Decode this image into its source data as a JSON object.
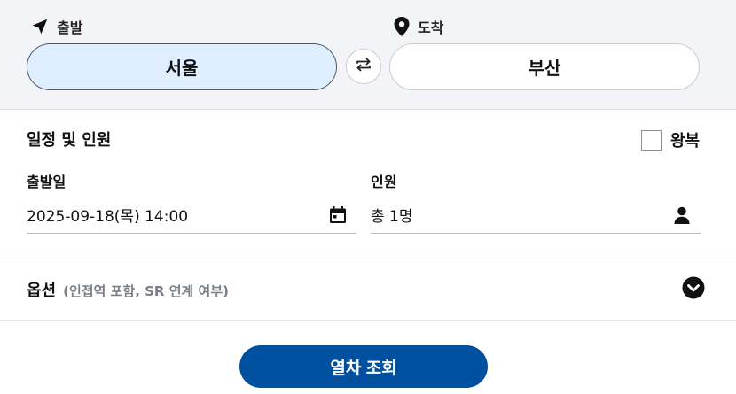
{
  "route": {
    "departure_label": "출발",
    "arrival_label": "도착",
    "departure_station": "서울",
    "arrival_station": "부산",
    "departure_icon": "navigation-arrow-icon",
    "arrival_icon": "map-pin-icon",
    "swap_icon": "swap-arrows-icon"
  },
  "schedule": {
    "title": "일정 및 인원",
    "roundtrip_label": "왕복",
    "roundtrip_checked": false,
    "date_label": "출발일",
    "date_value": "2025-09-18(목) 14:00",
    "date_icon": "calendar-icon",
    "passengers_label": "인원",
    "passengers_value": "총 1명",
    "passengers_icon": "person-icon"
  },
  "options": {
    "title": "옵션",
    "subtitle": "(인접역 포함, SR 연계 여부)",
    "toggle_icon": "chevron-down-circle-icon"
  },
  "search": {
    "button_label": "열차 조회",
    "button_color": "#0050a0"
  },
  "colors": {
    "departure_fill": "#e0efff",
    "top_background": "#f3f4f8"
  }
}
